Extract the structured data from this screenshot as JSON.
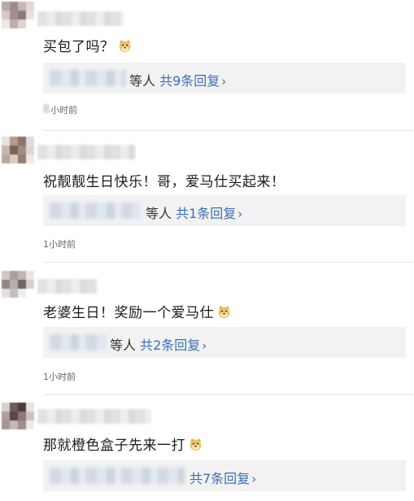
{
  "comments": [
    {
      "text": "买包了吗？",
      "reply_suffix": "等人",
      "reply_count_label": "共9条回复",
      "chevron": "›",
      "time": "小时前",
      "emoji_icon": "doge-emoji-icon"
    },
    {
      "text": "祝靓靓生日快乐！哥，爱马仕买起来！",
      "reply_suffix": "等人",
      "reply_count_label": "共1条回复",
      "chevron": "›",
      "time": "1小时前"
    },
    {
      "text": "老婆生日！奖励一个爱马仕",
      "reply_suffix": "等人",
      "reply_count_label": "共2条回复",
      "chevron": "›",
      "time": "1小时前",
      "emoji_icon": "doge-emoji-icon"
    },
    {
      "text": "那就橙色盒子先来一打",
      "reply_suffix": "",
      "reply_count_label": "共7条回复",
      "chevron": "›",
      "emoji_icon": "doge-emoji-icon"
    }
  ],
  "colors": {
    "link": "#3b6fb6",
    "reply_bg": "#f2f2f2",
    "text": "#1a1a1a"
  }
}
